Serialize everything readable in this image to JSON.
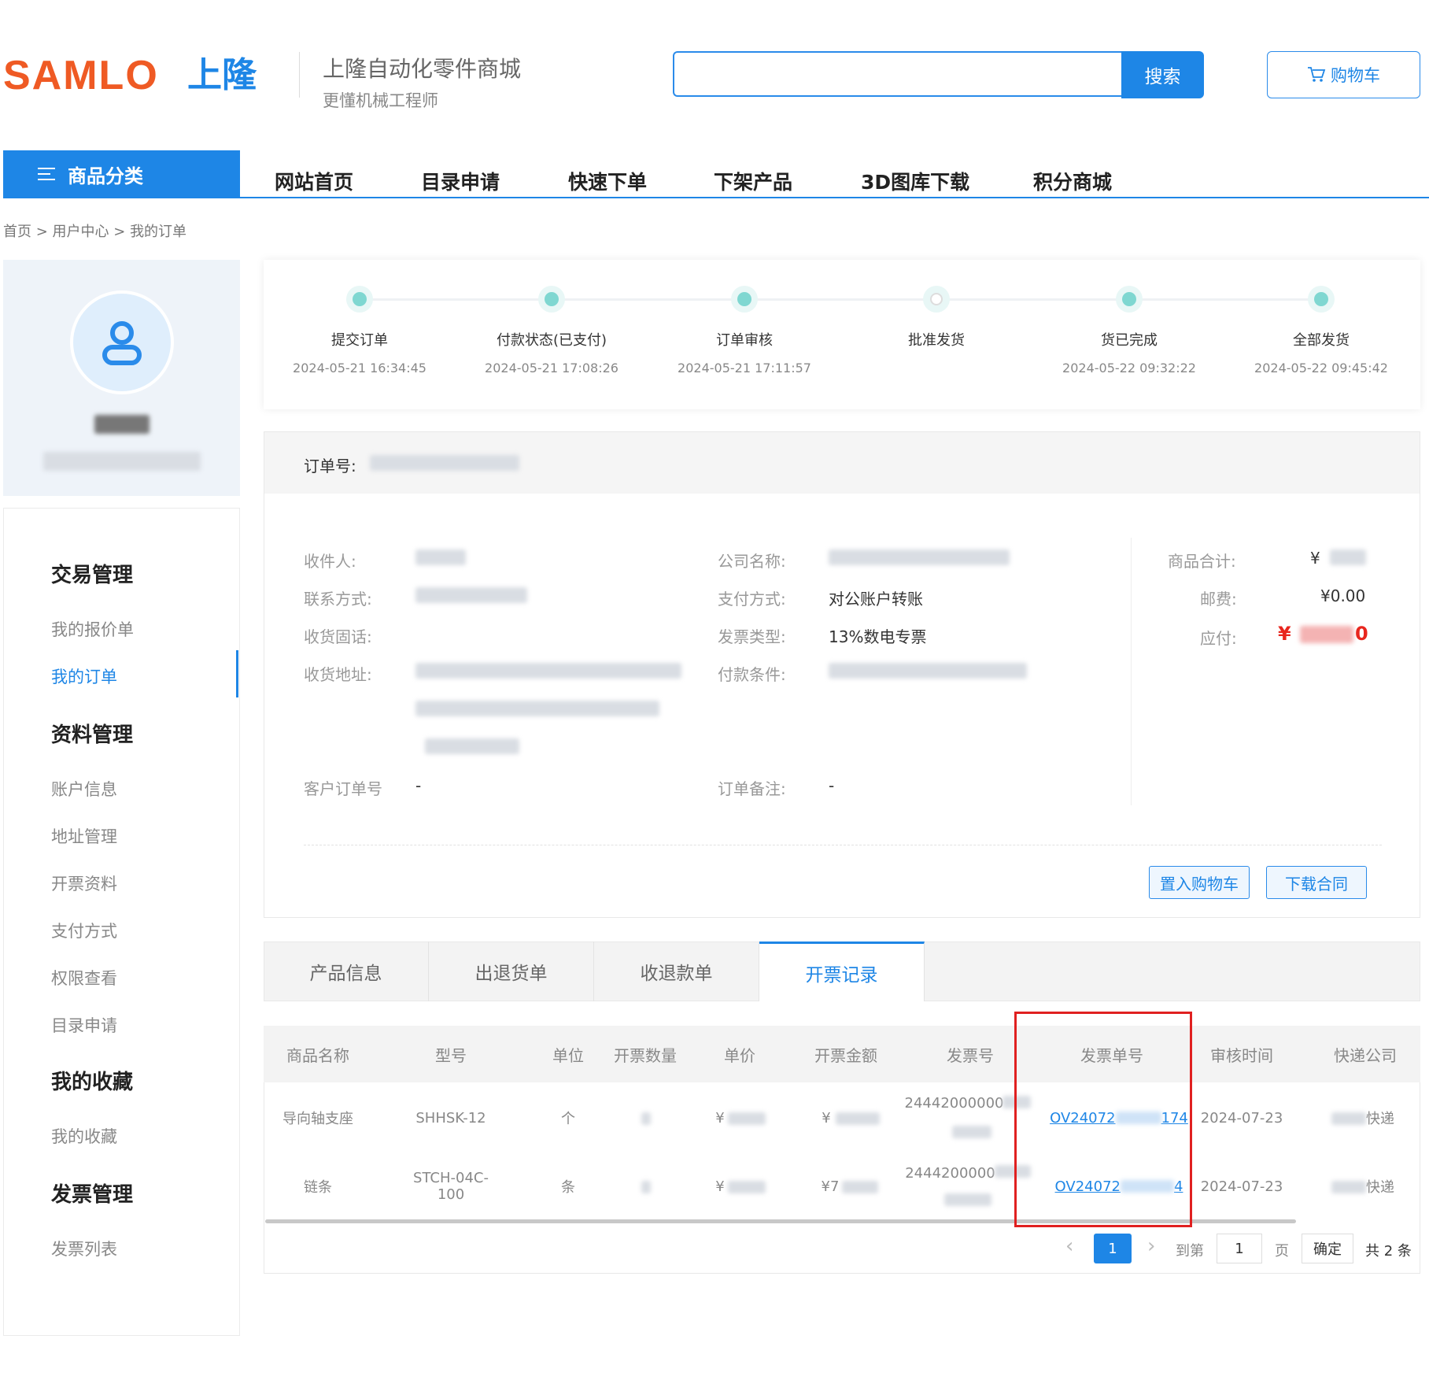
{
  "header": {
    "logo_en": "SAMLO",
    "logo_cn": "上隆",
    "site_title": "上隆自动化零件商城",
    "site_subtitle": "更懂机械工程师",
    "search_value": "",
    "search_label": "搜索",
    "cart_label": "购物车"
  },
  "nav": {
    "category_label": "商品分类",
    "items": [
      "网站首页",
      "目录申请",
      "快速下单",
      "下架产品",
      "3D图库下载",
      "积分商城"
    ]
  },
  "breadcrumb": [
    "首页",
    "用户中心",
    "我的订单"
  ],
  "sidebar": {
    "sections": [
      {
        "title": "交易管理",
        "items": [
          "我的报价单",
          "我的订单"
        ]
      },
      {
        "title": "资料管理",
        "items": [
          "账户信息",
          "地址管理",
          "开票资料",
          "支付方式",
          "权限查看",
          "目录申请"
        ]
      },
      {
        "title": "我的收藏",
        "items": [
          "我的收藏"
        ]
      },
      {
        "title": "发票管理",
        "items": [
          "发票列表"
        ]
      }
    ],
    "active_item": "我的订单"
  },
  "progress": {
    "steps": [
      {
        "label": "提交订单",
        "time": "2024-05-21 16:34:45",
        "done": true
      },
      {
        "label": "付款状态(已支付)",
        "time": "2024-05-21 17:08:26",
        "done": true
      },
      {
        "label": "订单审核",
        "time": "2024-05-21 17:11:57",
        "done": true
      },
      {
        "label": "批准发货",
        "time": "",
        "done": false
      },
      {
        "label": "货已完成",
        "time": "2024-05-22 09:32:22",
        "done": true
      },
      {
        "label": "全部发货",
        "time": "2024-05-22 09:45:42",
        "done": true
      }
    ]
  },
  "order": {
    "order_no_label": "订单号:",
    "labels": {
      "recipient": "收件人:",
      "contact": "联系方式:",
      "landline": "收货固话:",
      "address": "收货地址:",
      "customer_order_no": "客户订单号",
      "company": "公司名称:",
      "payment_method": "支付方式:",
      "invoice_type": "发票类型:",
      "payment_terms": "付款条件:",
      "remark": "订单备注:",
      "goods_total": "商品合计:",
      "shipping": "邮费:",
      "payable": "应付:"
    },
    "values": {
      "customer_order_no": "-",
      "payment_method": "对公账户转账",
      "invoice_type": "13%数电专票",
      "remark": "-",
      "goods_total_prefix": "¥",
      "shipping": "¥0.00",
      "payable_prefix": "¥",
      "payable_suffix": "0"
    },
    "buttons": {
      "add_to_cart": "置入购物车",
      "download_contract": "下载合同"
    }
  },
  "tabs": {
    "items": [
      "产品信息",
      "出退货单",
      "收退款单",
      "开票记录"
    ],
    "active": "开票记录"
  },
  "invoice_table": {
    "columns": [
      "商品名称",
      "型号",
      "单位",
      "开票数量",
      "单价",
      "开票金额",
      "发票号",
      "发票单号",
      "审核时间",
      "快递公司"
    ],
    "rows": [
      {
        "name": "导向轴支座",
        "model": "SHHSK-12",
        "unit": "个",
        "price_prefix": "¥",
        "amount_prefix": "¥",
        "invoice_no": "24442000000",
        "invoice_order_no_a": "OV24072",
        "invoice_order_no_b": "174",
        "audit_time": "2024-07-23",
        "courier": "快递"
      },
      {
        "name": "链条",
        "model": "STCH-04C-100",
        "unit": "条",
        "price_prefix": "¥",
        "amount_prefix": "¥7",
        "invoice_no": "2444200000",
        "invoice_order_no_a": "OV24072",
        "invoice_order_no_b": "4",
        "audit_time": "2024-07-23",
        "courier": "快递"
      }
    ]
  },
  "pagination": {
    "current": "1",
    "goto_label": "到第",
    "goto_value": "1",
    "page_label": "页",
    "confirm": "确定",
    "total": "共 2 条"
  },
  "colors": {
    "primary": "#1e86e6",
    "logo_orange": "#ef5a24",
    "price_red": "#e8261e",
    "step_teal": "#7fd7d1",
    "highlight_red": "#e02020"
  }
}
